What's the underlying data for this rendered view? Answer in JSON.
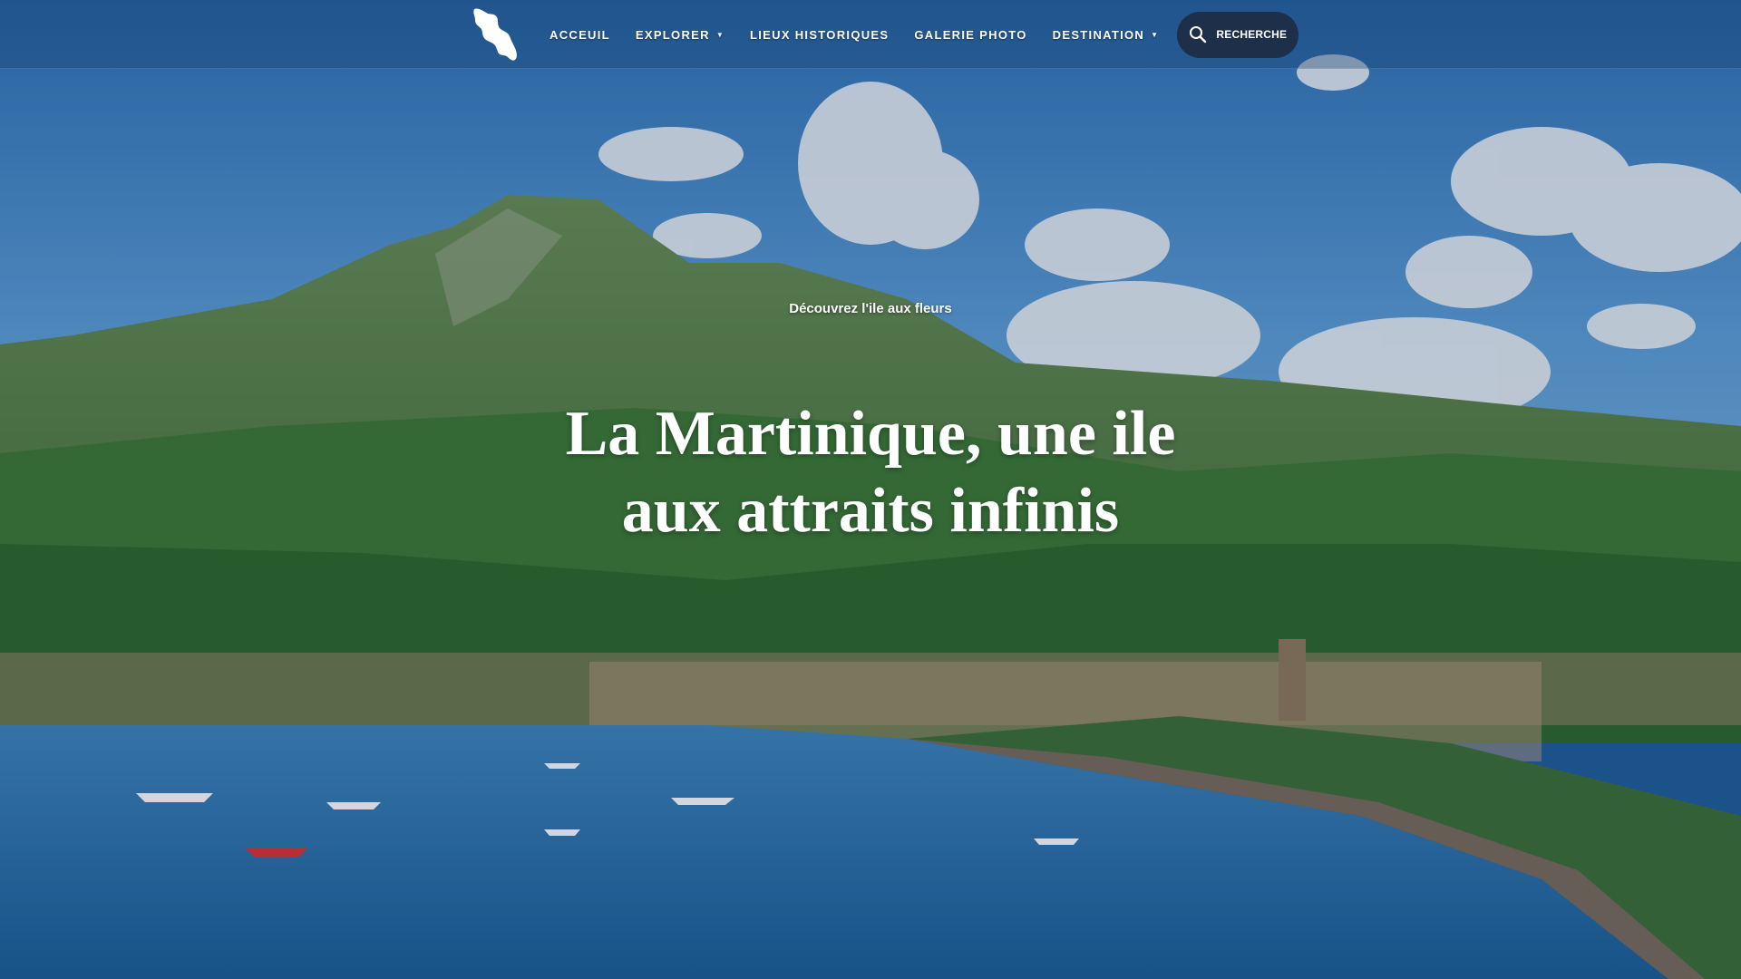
{
  "header": {
    "logo_icon": "martinique-island-icon",
    "nav": [
      {
        "label": "ACCEUIL",
        "has_dropdown": false
      },
      {
        "label": "EXPLORER",
        "has_dropdown": true
      },
      {
        "label": "LIEUX HISTORIQUES",
        "has_dropdown": false
      },
      {
        "label": "GALERIE PHOTO",
        "has_dropdown": false
      },
      {
        "label": "DESTINATION",
        "has_dropdown": true
      }
    ],
    "search": {
      "label": "RECHERCHE",
      "icon": "search-icon"
    }
  },
  "hero": {
    "kicker": "Découvrez l'ile aux fleurs",
    "headline": "La Martinique, une ile aux attraits infinis",
    "background_image": "bay-with-mountain-and-sailboats"
  },
  "colors": {
    "search_button_bg": "#1d2f49",
    "text": "#ffffff"
  }
}
